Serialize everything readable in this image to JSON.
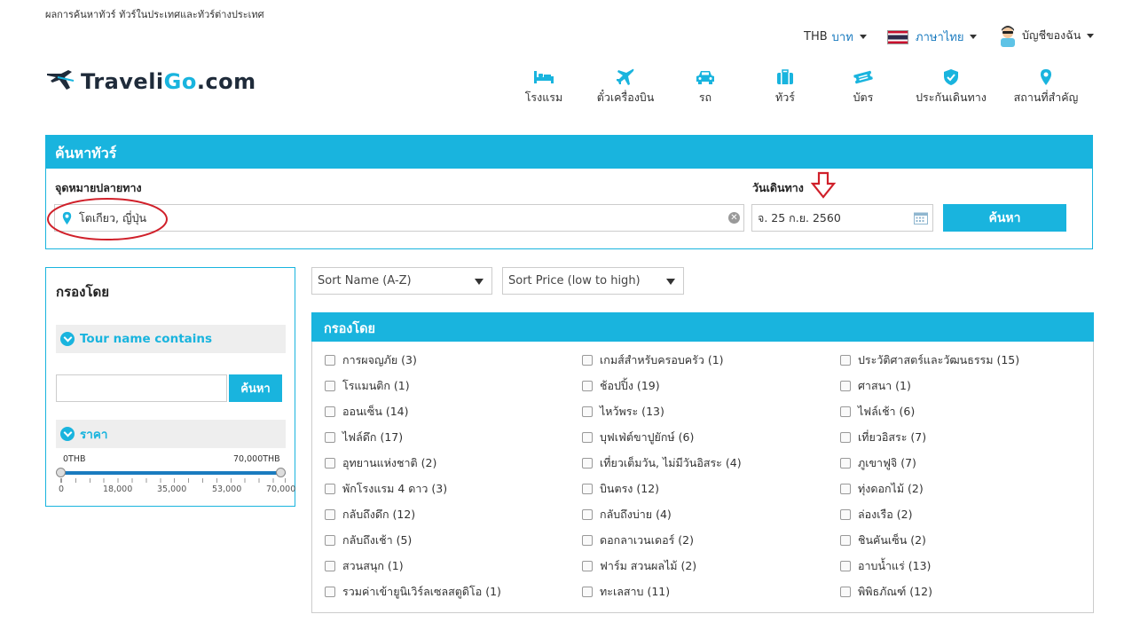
{
  "meta_line": "ผลการค้นหาทัวร์ ทัวร์ในประเทศและทัวร์ต่างประเทศ",
  "top": {
    "currency_code": "THB",
    "currency_name": "บาท",
    "language": "ภาษาไทย",
    "account": "บัญชีของฉัน"
  },
  "logo": {
    "part1": "Traveli",
    "part2": "Go",
    "part3": ".com"
  },
  "nav": [
    {
      "label": "โรงแรม",
      "icon": "bed-icon"
    },
    {
      "label": "ตั๋วเครื่องบิน",
      "icon": "plane-icon"
    },
    {
      "label": "รถ",
      "icon": "car-icon"
    },
    {
      "label": "ทัวร์",
      "icon": "suitcase-icon"
    },
    {
      "label": "บัตร",
      "icon": "ticket-icon"
    },
    {
      "label": "ประกันเดินทาง",
      "icon": "shield-icon"
    },
    {
      "label": "สถานที่สำคัญ",
      "icon": "map-pin-icon"
    }
  ],
  "search": {
    "title": "ค้นหาทัวร์",
    "destination_label": "จุดหมายปลายทาง",
    "destination_value": "โตเกียว, ญี่ปุ่น",
    "date_label": "วันเดินทาง",
    "date_value": "จ. 25 ก.ย. 2560",
    "button": "ค้นหา"
  },
  "sidebar": {
    "title": "กรองโดย",
    "tour_name_label": "Tour name contains",
    "tour_name_value": "",
    "search_button": "ค้นหา",
    "price_label": "ราคา",
    "price_min": "0THB",
    "price_max": "70,000THB",
    "price_ticks": [
      "0",
      "18,000",
      "35,000",
      "53,000",
      "70,000"
    ]
  },
  "sort": {
    "name": "Sort Name (A-Z)",
    "price": "Sort Price (low to high)"
  },
  "categories": {
    "title": "กรองโดย",
    "columns": [
      [
        "การผจญภัย (3)",
        "โรแมนติก (1)",
        "ออนเซ็น (14)",
        "ไฟล์ดึก (17)",
        "อุทยานแห่งชาติ (2)",
        "พักโรงแรม 4 ดาว (3)",
        "กลับถึงดึก (12)",
        "กลับถึงเช้า (5)",
        "สวนสนุก (1)",
        "รวมค่าเข้ายูนิเวิร์ลเซลสตูดิโอ (1)"
      ],
      [
        "เกมส์สำหรับครอบครัว (1)",
        "ช้อปปิ้ง (19)",
        "ไหว้พระ (13)",
        "บุฟเฟ่ต์ขาปูยักษ์ (6)",
        "เที่ยวเต็มวัน, ไม่มีวันอิสระ (4)",
        "บินตรง (12)",
        "กลับถึงบ่าย (4)",
        "ดอกลาเวนเดอร์ (2)",
        "ฟาร์ม สวนผลไม้ (2)",
        "ทะเลสาบ (11)"
      ],
      [
        "ประวัติศาสตร์และวัฒนธรรม (15)",
        "ศาสนา (1)",
        "ไฟล์เช้า (6)",
        "เที่ยวอิสระ (7)",
        "ภูเขาฟูจิ (7)",
        "ทุ่งดอกไม้ (2)",
        "ล่องเรือ (2)",
        "ชินคันเซ็น (2)",
        "อาบน้ำแร่ (13)",
        "พิพิธภัณฑ์ (12)"
      ]
    ]
  },
  "colors": {
    "accent": "#19b4de",
    "annotation_red": "#d0202a",
    "logo_dark": "#1f2b3a"
  }
}
